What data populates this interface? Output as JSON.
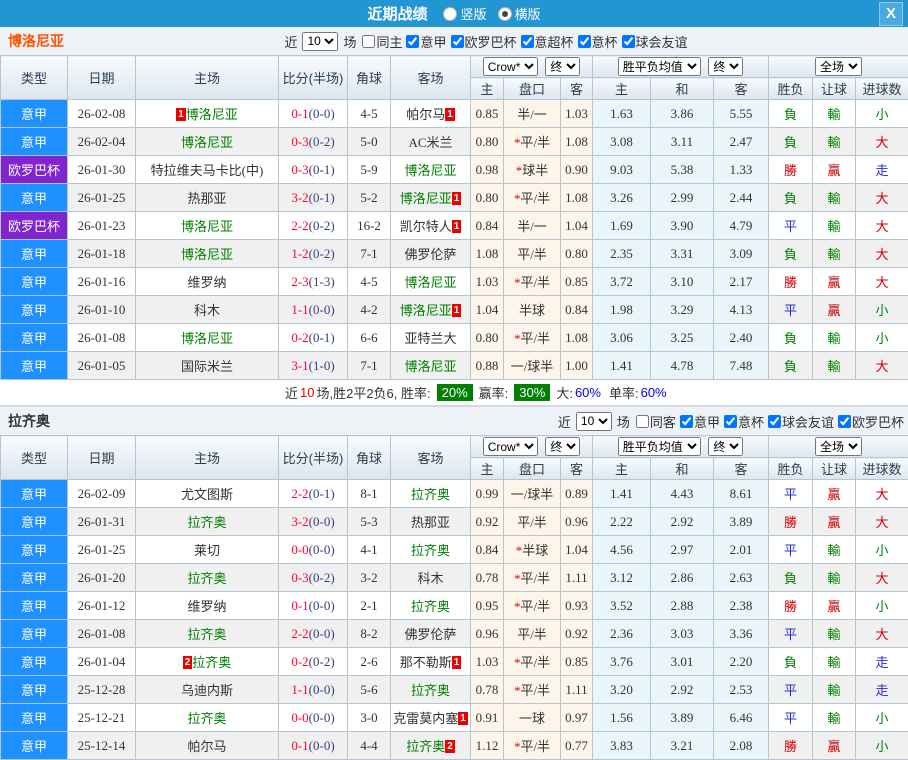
{
  "topbar": {
    "title": "近期战绩",
    "radio_vertical": "竖版",
    "radio_horizontal": "横版",
    "close_label": "X"
  },
  "controls": {
    "near_label": "近",
    "count": "10",
    "games_label": "场"
  },
  "headers": {
    "type": "类型",
    "date": "日期",
    "home": "主场",
    "score": "比分(半场)",
    "corner": "角球",
    "away": "客场",
    "crow_select": "Crow*",
    "final_select": "终",
    "avg_select": "胜平负均值",
    "full_select": "全场",
    "h": "主",
    "handicap": "盘口",
    "a": "客",
    "avg_h": "主",
    "avg_d": "和",
    "avg_a": "客",
    "wl": "胜负",
    "let_goal": "让球",
    "goals": "进球数"
  },
  "type_colors": {
    "意甲": "#1e90ff",
    "欧罗巴杯": "#7f24cf"
  },
  "result_colors": {
    "勝": "#cc0000",
    "贏": "#cc0000",
    "大": "#cc0000",
    "負": "#008000",
    "輸": "#008000",
    "小": "#008000",
    "平": "#2929d6",
    "走": "#2929d6"
  },
  "sections": [
    {
      "team": "博洛尼亚",
      "title_color": "#ff5500",
      "filters": [
        {
          "label": "同主",
          "checked": false
        },
        {
          "label": "意甲",
          "checked": true
        },
        {
          "label": "欧罗巴杯",
          "checked": true
        },
        {
          "label": "意超杯",
          "checked": true
        },
        {
          "label": "意杯",
          "checked": true
        },
        {
          "label": "球会友谊",
          "checked": true
        }
      ],
      "rows": [
        {
          "type": "意甲",
          "date": "26-02-08",
          "home_badge": "1",
          "home": "博洛尼亚",
          "home_green": true,
          "ft": "0-1",
          "ht": "(0-0)",
          "corner": "4-5",
          "away": "帕尔马",
          "away_green": false,
          "away_badge": "1",
          "o1": "0.85",
          "star": false,
          "hc": "半/一",
          "o2": "1.03",
          "m1": "1.63",
          "m2": "3.86",
          "m3": "5.55",
          "r1": "負",
          "r2": "輸",
          "r3": "小"
        },
        {
          "type": "意甲",
          "date": "26-02-04",
          "home": "博洛尼亚",
          "home_green": true,
          "ft": "0-3",
          "ht": "(0-2)",
          "corner": "5-0",
          "away": "AC米兰",
          "away_green": false,
          "o1": "0.80",
          "star": true,
          "hc": "平/半",
          "o2": "1.08",
          "m1": "3.08",
          "m2": "3.11",
          "m3": "2.47",
          "r1": "負",
          "r2": "輸",
          "r3": "大"
        },
        {
          "type": "欧罗巴杯",
          "date": "26-01-30",
          "home": "特拉维夫马卡比(中)",
          "home_green": false,
          "ft": "0-3",
          "ht": "(0-1)",
          "corner": "5-9",
          "away": "博洛尼亚",
          "away_green": true,
          "o1": "0.98",
          "star": true,
          "hc": "球半",
          "o2": "0.90",
          "m1": "9.03",
          "m2": "5.38",
          "m3": "1.33",
          "r1": "勝",
          "r2": "贏",
          "r3": "走"
        },
        {
          "type": "意甲",
          "date": "26-01-25",
          "home": "热那亚",
          "home_green": false,
          "ft": "3-2",
          "ht": "(0-1)",
          "corner": "5-2",
          "away": "博洛尼亚",
          "away_green": true,
          "away_badge": "1",
          "o1": "0.80",
          "star": true,
          "hc": "平/半",
          "o2": "1.08",
          "m1": "3.26",
          "m2": "2.99",
          "m3": "2.44",
          "r1": "負",
          "r2": "輸",
          "r3": "大"
        },
        {
          "type": "欧罗巴杯",
          "date": "26-01-23",
          "home": "博洛尼亚",
          "home_green": true,
          "ft": "2-2",
          "ht": "(0-2)",
          "corner": "16-2",
          "away": "凯尔特人",
          "away_green": false,
          "away_badge": "1",
          "o1": "0.84",
          "star": false,
          "hc": "半/一",
          "o2": "1.04",
          "m1": "1.69",
          "m2": "3.90",
          "m3": "4.79",
          "r1": "平",
          "r2": "輸",
          "r3": "大"
        },
        {
          "type": "意甲",
          "date": "26-01-18",
          "home": "博洛尼亚",
          "home_green": true,
          "ft": "1-2",
          "ht": "(0-2)",
          "corner": "7-1",
          "away": "佛罗伦萨",
          "away_green": false,
          "o1": "1.08",
          "star": false,
          "hc": "平/半",
          "o2": "0.80",
          "m1": "2.35",
          "m2": "3.31",
          "m3": "3.09",
          "r1": "負",
          "r2": "輸",
          "r3": "大"
        },
        {
          "type": "意甲",
          "date": "26-01-16",
          "home": "维罗纳",
          "home_green": false,
          "ft": "2-3",
          "ht": "(1-3)",
          "corner": "4-5",
          "away": "博洛尼亚",
          "away_green": true,
          "o1": "1.03",
          "star": true,
          "hc": "平/半",
          "o2": "0.85",
          "m1": "3.72",
          "m2": "3.10",
          "m3": "2.17",
          "r1": "勝",
          "r2": "贏",
          "r3": "大"
        },
        {
          "type": "意甲",
          "date": "26-01-10",
          "home": "科木",
          "home_green": false,
          "ft": "1-1",
          "ht": "(0-0)",
          "corner": "4-2",
          "away": "博洛尼亚",
          "away_green": true,
          "away_badge": "1",
          "o1": "1.04",
          "star": false,
          "hc": "半球",
          "o2": "0.84",
          "m1": "1.98",
          "m2": "3.29",
          "m3": "4.13",
          "r1": "平",
          "r2": "贏",
          "r3": "小"
        },
        {
          "type": "意甲",
          "date": "26-01-08",
          "home": "博洛尼亚",
          "home_green": true,
          "ft": "0-2",
          "ht": "(0-1)",
          "corner": "6-6",
          "away": "亚特兰大",
          "away_green": false,
          "o1": "0.80",
          "star": true,
          "hc": "平/半",
          "o2": "1.08",
          "m1": "3.06",
          "m2": "3.25",
          "m3": "2.40",
          "r1": "負",
          "r2": "輸",
          "r3": "小"
        },
        {
          "type": "意甲",
          "date": "26-01-05",
          "home": "国际米兰",
          "home_green": false,
          "ft": "3-1",
          "ht": "(1-0)",
          "corner": "7-1",
          "away": "博洛尼亚",
          "away_green": true,
          "o1": "0.88",
          "star": false,
          "hc": "一/球半",
          "o2": "1.00",
          "m1": "1.41",
          "m2": "4.78",
          "m3": "7.48",
          "r1": "負",
          "r2": "輸",
          "r3": "大"
        }
      ],
      "summary": {
        "near": "近",
        "n": "10",
        "seg1": "场,胜2平2负6, 胜率:",
        "pct1": "20%",
        "seg2": "赢率:",
        "pct2": "30%",
        "seg3": "大:",
        "pct3": "60%",
        "seg4": "单率:",
        "pct4": "60%"
      }
    },
    {
      "team": "拉齐奥",
      "title_color": "#333333",
      "filters": [
        {
          "label": "同客",
          "checked": false
        },
        {
          "label": "意甲",
          "checked": true
        },
        {
          "label": "意杯",
          "checked": true
        },
        {
          "label": "球会友谊",
          "checked": true
        },
        {
          "label": "欧罗巴杯",
          "checked": true
        }
      ],
      "rows": [
        {
          "type": "意甲",
          "date": "26-02-09",
          "home": "尤文图斯",
          "home_green": false,
          "ft": "2-2",
          "ht": "(0-1)",
          "corner": "8-1",
          "away": "拉齐奥",
          "away_green": true,
          "o1": "0.99",
          "star": false,
          "hc": "一/球半",
          "o2": "0.89",
          "m1": "1.41",
          "m2": "4.43",
          "m3": "8.61",
          "r1": "平",
          "r2": "贏",
          "r3": "大"
        },
        {
          "type": "意甲",
          "date": "26-01-31",
          "home": "拉齐奥",
          "home_green": true,
          "ft": "3-2",
          "ht": "(0-0)",
          "corner": "5-3",
          "away": "热那亚",
          "away_green": false,
          "o1": "0.92",
          "star": false,
          "hc": "平/半",
          "o2": "0.96",
          "m1": "2.22",
          "m2": "2.92",
          "m3": "3.89",
          "r1": "勝",
          "r2": "贏",
          "r3": "大"
        },
        {
          "type": "意甲",
          "date": "26-01-25",
          "home": "莱切",
          "home_green": false,
          "ft": "0-0",
          "ht": "(0-0)",
          "corner": "4-1",
          "away": "拉齐奥",
          "away_green": true,
          "o1": "0.84",
          "star": true,
          "hc": "半球",
          "o2": "1.04",
          "m1": "4.56",
          "m2": "2.97",
          "m3": "2.01",
          "r1": "平",
          "r2": "輸",
          "r3": "小"
        },
        {
          "type": "意甲",
          "date": "26-01-20",
          "home": "拉齐奥",
          "home_green": true,
          "ft": "0-3",
          "ht": "(0-2)",
          "corner": "3-2",
          "away": "科木",
          "away_green": false,
          "o1": "0.78",
          "star": true,
          "hc": "平/半",
          "o2": "1.11",
          "m1": "3.12",
          "m2": "2.86",
          "m3": "2.63",
          "r1": "負",
          "r2": "輸",
          "r3": "大"
        },
        {
          "type": "意甲",
          "date": "26-01-12",
          "home": "维罗纳",
          "home_green": false,
          "ft": "0-1",
          "ht": "(0-0)",
          "corner": "2-1",
          "away": "拉齐奥",
          "away_green": true,
          "o1": "0.95",
          "star": true,
          "hc": "平/半",
          "o2": "0.93",
          "m1": "3.52",
          "m2": "2.88",
          "m3": "2.38",
          "r1": "勝",
          "r2": "贏",
          "r3": "小"
        },
        {
          "type": "意甲",
          "date": "26-01-08",
          "home": "拉齐奥",
          "home_green": true,
          "ft": "2-2",
          "ht": "(0-0)",
          "corner": "8-2",
          "away": "佛罗伦萨",
          "away_green": false,
          "o1": "0.96",
          "star": false,
          "hc": "平/半",
          "o2": "0.92",
          "m1": "2.36",
          "m2": "3.03",
          "m3": "3.36",
          "r1": "平",
          "r2": "輸",
          "r3": "大"
        },
        {
          "type": "意甲",
          "date": "26-01-04",
          "home_badge": "2",
          "home": "拉齐奥",
          "home_green": true,
          "ft": "0-2",
          "ht": "(0-2)",
          "corner": "2-6",
          "away": "那不勒斯",
          "away_green": false,
          "away_badge": "1",
          "o1": "1.03",
          "star": true,
          "hc": "平/半",
          "o2": "0.85",
          "m1": "3.76",
          "m2": "3.01",
          "m3": "2.20",
          "r1": "負",
          "r2": "輸",
          "r3": "走"
        },
        {
          "type": "意甲",
          "date": "25-12-28",
          "home": "乌迪内斯",
          "home_green": false,
          "ft": "1-1",
          "ht": "(0-0)",
          "corner": "5-6",
          "away": "拉齐奥",
          "away_green": true,
          "o1": "0.78",
          "star": true,
          "hc": "平/半",
          "o2": "1.11",
          "m1": "3.20",
          "m2": "2.92",
          "m3": "2.53",
          "r1": "平",
          "r2": "輸",
          "r3": "走"
        },
        {
          "type": "意甲",
          "date": "25-12-21",
          "home": "拉齐奥",
          "home_green": true,
          "ft": "0-0",
          "ht": "(0-0)",
          "corner": "3-0",
          "away": "克雷莫内塞",
          "away_green": false,
          "away_badge": "1",
          "o1": "0.91",
          "star": false,
          "hc": "一球",
          "o2": "0.97",
          "m1": "1.56",
          "m2": "3.89",
          "m3": "6.46",
          "r1": "平",
          "r2": "輸",
          "r3": "小"
        },
        {
          "type": "意甲",
          "date": "25-12-14",
          "home": "帕尔马",
          "home_green": false,
          "ft": "0-1",
          "ht": "(0-0)",
          "corner": "4-4",
          "away": "拉齐奥",
          "away_green": true,
          "away_badge": "2",
          "o1": "1.12",
          "star": true,
          "hc": "平/半",
          "o2": "0.77",
          "m1": "3.83",
          "m2": "3.21",
          "m3": "2.08",
          "r1": "勝",
          "r2": "贏",
          "r3": "小"
        }
      ],
      "summary": null
    }
  ]
}
